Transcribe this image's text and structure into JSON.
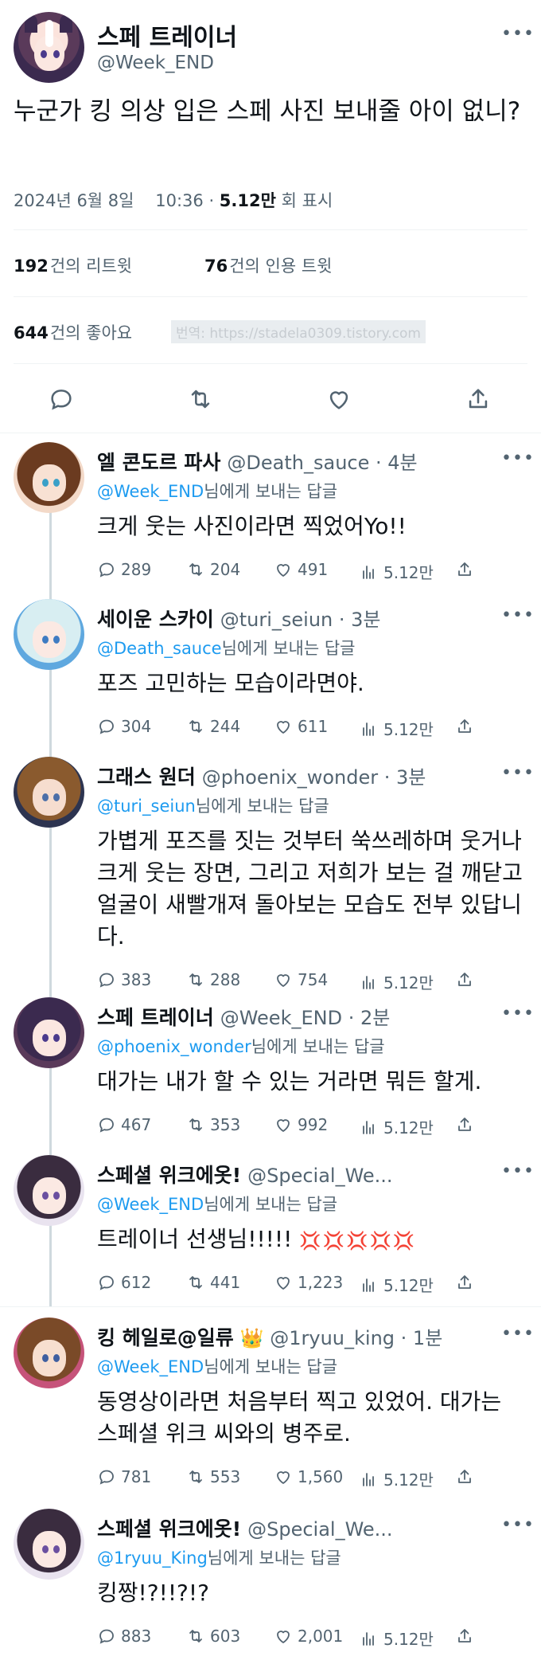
{
  "main": {
    "name": "스페 트레이너",
    "handle": "@Week_END",
    "text": "누군가 킹 의상 입은 스페 사진 보내줄 아이 없니?",
    "date": "2024년 6월 8일",
    "time": "10:36",
    "views_count": "5.12만",
    "views_label": "회 표시",
    "retweets_count": "192",
    "retweets_label": "건의 리트윗",
    "quotes_count": "76",
    "quotes_label": "건의 인용 트윗",
    "likes_count": "644",
    "likes_label": "건의 좋아요",
    "translation_watermark": "번역: https://stadela0309.tistory.com"
  },
  "reply_prefix_suffix": "님에게 보내는 답글",
  "replies": [
    {
      "name": "엘 콘도르 파사",
      "handle": "@Death_sauce",
      "time": "· 4분",
      "reply_to": "@Week_END",
      "text": "크게 웃는 사진이라면 찍었어Yo!!",
      "replies": "289",
      "retweets": "204",
      "likes": "491",
      "views": "5.12만",
      "avatar_colors": {
        "hair": "#6b3b20",
        "bg": "#f3d9c8",
        "face": "#f8e1d3",
        "eye": "#3aa0c8"
      }
    },
    {
      "name": "세이운 스카이",
      "handle": "@turi_seiun",
      "time": "· 3분",
      "reply_to": "@Death_sauce",
      "text": "포즈 고민하는 모습이라면야.",
      "replies": "304",
      "retweets": "244",
      "likes": "611",
      "views": "5.12만",
      "avatar_colors": {
        "hair": "#d8eef2",
        "bg": "#5fa8df",
        "face": "#fbe9e3",
        "eye": "#3e7bc2"
      }
    },
    {
      "name": "그래스 원더",
      "handle": "@phoenix_wonder",
      "time": "· 3분",
      "reply_to": "@turi_seiun",
      "text": "가볍게 포즈를 짓는 것부터 쑥쓰레하며 웃거나 크게 웃는 장면, 그리고 저희가 보는 걸 깨닫고 얼굴이 새빨개져 돌아보는 모습도 전부 있답니다.",
      "replies": "383",
      "retweets": "288",
      "likes": "754",
      "views": "5.12만",
      "avatar_colors": {
        "hair": "#8a5a2e",
        "bg": "#2d3450",
        "face": "#f6ddcf",
        "eye": "#4c6fa8"
      }
    },
    {
      "name": "스페 트레이너",
      "handle": "@Week_END",
      "time": "· 2분",
      "reply_to": "@phoenix_wonder",
      "text": "대가는 내가 할 수 있는 거라면 뭐든 할게.",
      "replies": "467",
      "retweets": "353",
      "likes": "992",
      "views": "5.12만",
      "avatar_colors": {
        "hair": "#3b2a4f",
        "bg": "#5a3a5a",
        "face": "#fbe7e1",
        "eye": "#4a3a8c"
      }
    },
    {
      "name": "스페셜 위크에옷!",
      "handle": "@Special_We...",
      "time": "",
      "reply_to": "@Week_END",
      "text": "트레이너 선생님!!!!!",
      "emoji": "💢💢💢💢💢",
      "replies": "612",
      "retweets": "441",
      "likes": "1,223",
      "views": "5.12만",
      "avatar_colors": {
        "hair": "#3a2c3f",
        "bg": "#e9e3ef",
        "face": "#fbe9e3",
        "eye": "#6a4fa0"
      }
    },
    {
      "name": "킹 헤일로@일류",
      "crown": "👑",
      "handle": "@1ryuu_king",
      "time": "· 1분",
      "reply_to": "@Week_END",
      "text": "동영상이라면 처음부터 찍고 있었어. 대가는 스페셜 위크 씨와의 병주로.",
      "replies": "781",
      "retweets": "553",
      "likes": "1,560",
      "views": "5.12만",
      "avatar_colors": {
        "hair": "#7a4a28",
        "bg": "#c6537a",
        "face": "#f7dfcf",
        "eye": "#3e5fa0"
      }
    },
    {
      "name": "스페셜 위크에옷!",
      "handle": "@Special_We...",
      "time": "",
      "reply_to": "@1ryuu_King",
      "text": "킹짱!?!!?!?",
      "replies": "883",
      "retweets": "603",
      "likes": "2,001",
      "views": "5.12만",
      "avatar_colors": {
        "hair": "#3a2c3f",
        "bg": "#e9e3ef",
        "face": "#fbe9e3",
        "eye": "#6a4fa0"
      }
    }
  ],
  "icons": [
    "reply-icon",
    "retweet-icon",
    "like-icon",
    "views-icon",
    "share-icon",
    "more-icon"
  ]
}
